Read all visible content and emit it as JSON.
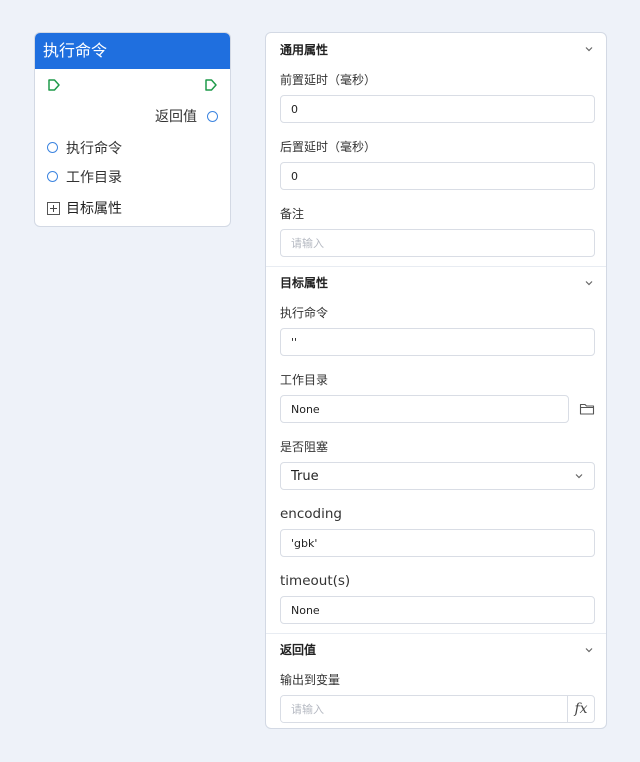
{
  "node": {
    "title": "执行命令",
    "output_port": "返回值",
    "inputs": [
      "执行命令",
      "工作目录"
    ],
    "expand_label": "目标属性"
  },
  "panel": {
    "general": {
      "title": "通用属性",
      "pre_delay_label": "前置延时（毫秒）",
      "pre_delay_value": "0",
      "post_delay_label": "后置延时（毫秒）",
      "post_delay_value": "0",
      "remark_label": "备注",
      "remark_placeholder": "请输入"
    },
    "target": {
      "title": "目标属性",
      "command_label": "执行命令",
      "command_value": "''",
      "workdir_label": "工作目录",
      "workdir_value": "None",
      "blocking_label": "是否阻塞",
      "blocking_value": "True",
      "encoding_label": "encoding",
      "encoding_value": "'gbk'",
      "timeout_label": "timeout(s)",
      "timeout_value": "None"
    },
    "return": {
      "title": "返回值",
      "output_label": "输出到变量",
      "output_placeholder": "请输入",
      "fx_label": "fx"
    }
  },
  "colors": {
    "accent": "#1f6fdf",
    "flow_port": "#1f9a4a",
    "data_port": "#3d85e0",
    "background": "#eef2f9"
  },
  "icons": [
    "flow-in-port-icon",
    "flow-out-port-icon",
    "chevron-down-icon",
    "folder-icon",
    "expand-plus-icon"
  ]
}
